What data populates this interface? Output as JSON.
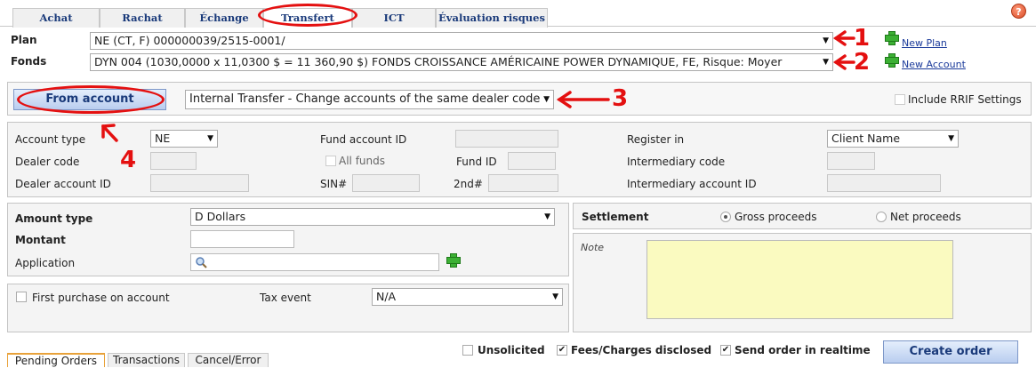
{
  "tabs": [
    "Achat",
    "Rachat",
    "Échange",
    "Transfert",
    "ICT",
    "Évaluation risques"
  ],
  "help_icon": "?",
  "plan": {
    "label": "Plan",
    "value": "NE (CT, F) 000000039/2515-0001/",
    "link": "New Plan"
  },
  "fonds": {
    "label": "Fonds",
    "value": "DYN 004 (1030,0000 x 11,0300 $ = 11 360,90 $) FONDS CROISSANCE AMÉRICAINE POWER DYNAMIQUE, FE, Risque: Moyer",
    "link": "New Account"
  },
  "from_account": {
    "label": "From account",
    "transfer_type": "Internal Transfer - Change accounts of the same dealer code",
    "include_rrif": "Include RRIF Settings"
  },
  "account": {
    "account_type_label": "Account type",
    "account_type_value": "NE",
    "dealer_code_label": "Dealer code",
    "dealer_account_id_label": "Dealer account ID",
    "fund_account_id_label": "Fund account ID",
    "all_funds_label": "All funds",
    "fund_id_label": "Fund ID",
    "sin_label": "SIN#",
    "second_label": "2nd#",
    "register_in_label": "Register in",
    "register_in_value": "Client Name",
    "intermediary_code_label": "Intermediary code",
    "intermediary_account_id_label": "Intermediary account ID"
  },
  "amount": {
    "amount_type_label": "Amount type",
    "amount_type_value": "D Dollars",
    "montant_label": "Montant",
    "application_label": "Application"
  },
  "settlement": {
    "label": "Settlement",
    "gross": "Gross proceeds",
    "net": "Net proceeds",
    "note_label": "Note"
  },
  "purchase": {
    "first_purchase": "First purchase on account",
    "tax_event_label": "Tax event",
    "tax_event_value": "N/A"
  },
  "footer": {
    "unsolicited": "Unsolicited",
    "fees_disclosed": "Fees/Charges disclosed",
    "send_realtime": "Send order in realtime",
    "create_order": "Create order"
  },
  "bottom_tabs": [
    "Pending Orders",
    "Transactions",
    "Cancel/Error"
  ],
  "annotations": [
    "1",
    "2",
    "3",
    "4"
  ],
  "colors": {
    "annotation": "#e41010",
    "link": "#1a3a9a",
    "note_bg": "#fafac0",
    "button_blue": "#b9cdef"
  }
}
